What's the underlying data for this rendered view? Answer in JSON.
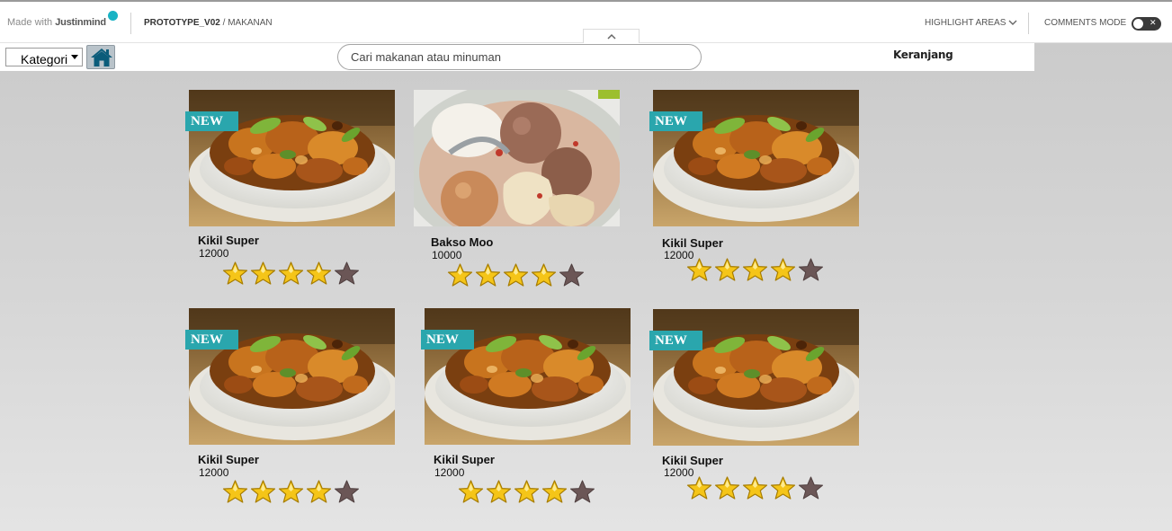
{
  "jm_bar": {
    "made_with": "Made with",
    "brand": "Justinmind",
    "project": "PROTOTYPE_V02",
    "separator": " / ",
    "page": "MAKANAN",
    "highlight_areas": "HIGHLIGHT AREAS",
    "comments_mode": "COMMENTS MODE"
  },
  "header": {
    "kategori_label": "Kategori",
    "search_placeholder": "Cari makanan atau minuman",
    "cart_label": "Keranjang"
  },
  "products": [
    {
      "name": "Kikil Super",
      "price": "12000",
      "badge": "NEW",
      "image": "kikil",
      "rating": 4,
      "max_rating": 5
    },
    {
      "name": "Bakso Moo",
      "price": "10000",
      "badge": "",
      "image": "bakso",
      "rating": 4,
      "max_rating": 5
    },
    {
      "name": "Kikil Super",
      "price": "12000",
      "badge": "NEW",
      "image": "kikil",
      "rating": 4,
      "max_rating": 5
    },
    {
      "name": "Kikil Super",
      "price": "12000",
      "badge": "NEW",
      "image": "kikil",
      "rating": 4,
      "max_rating": 5
    },
    {
      "name": "Kikil Super",
      "price": "12000",
      "badge": "NEW",
      "image": "kikil",
      "rating": 4,
      "max_rating": 5
    },
    {
      "name": "Kikil Super",
      "price": "12000",
      "badge": "NEW",
      "image": "kikil",
      "rating": 4,
      "max_rating": 5
    }
  ],
  "icons": {
    "home": "home-icon",
    "star_filled": "star-filled-icon",
    "star_empty": "star-empty-icon"
  },
  "colors": {
    "badge": "#2aa6ad",
    "star_filled": "#f5c518",
    "star_empty": "#6b5656",
    "brand_dot": "#19b3c4"
  }
}
